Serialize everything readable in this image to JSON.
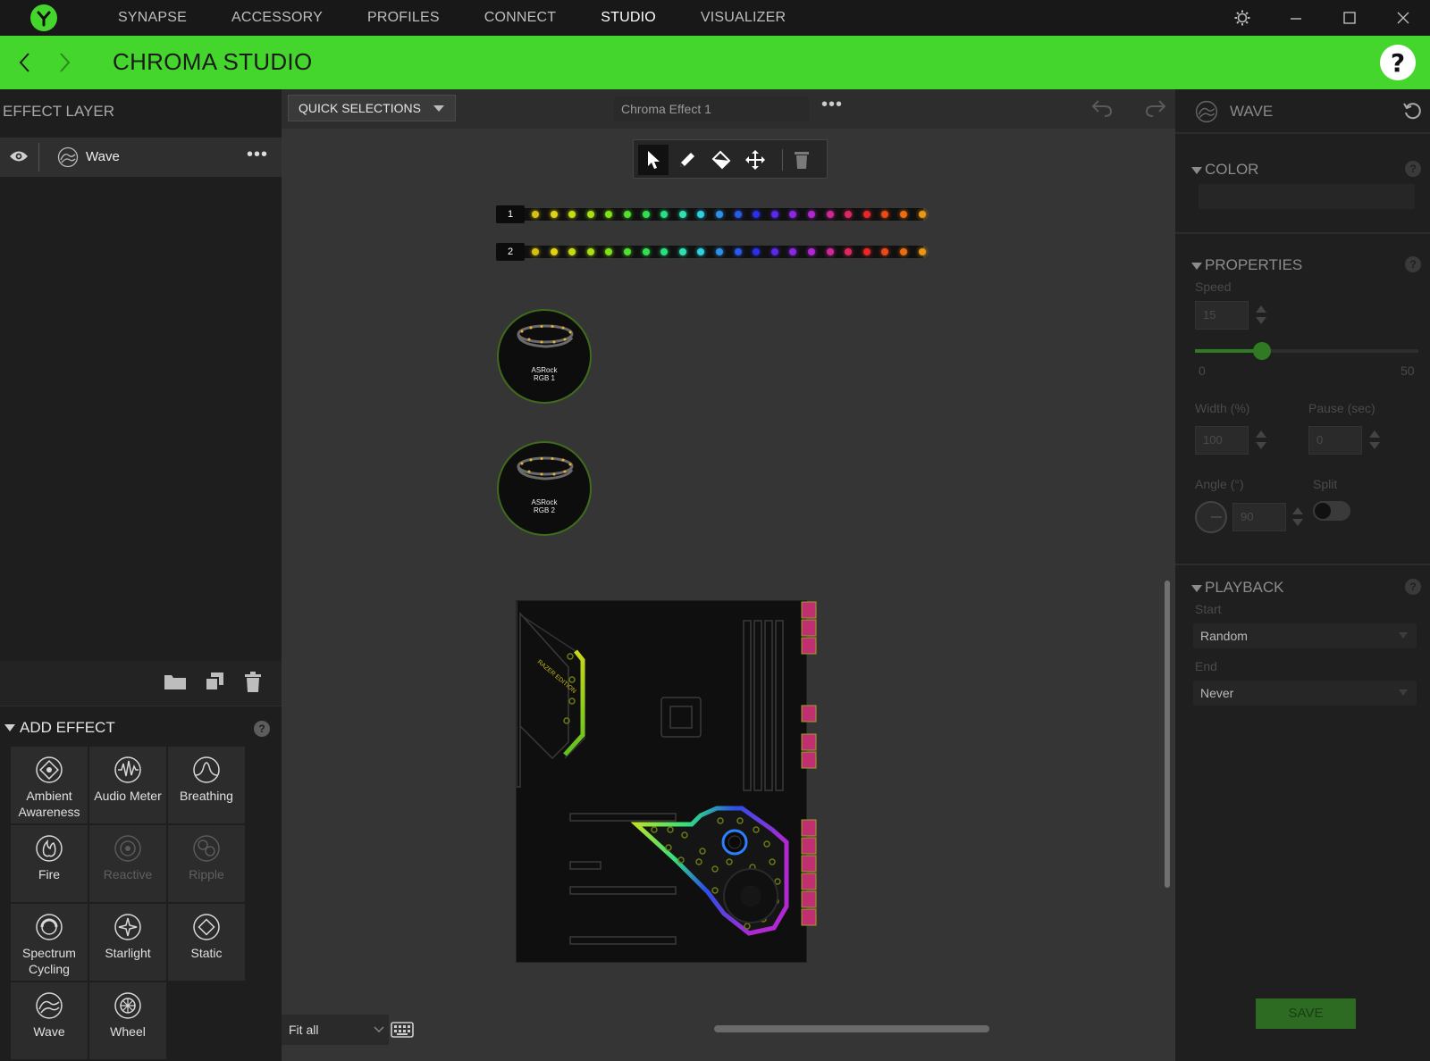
{
  "nav": {
    "items": [
      "SYNAPSE",
      "ACCESSORY",
      "PROFILES",
      "CONNECT",
      "STUDIO",
      "VISUALIZER"
    ],
    "active_index": 4
  },
  "header": {
    "title": "CHROMA STUDIO",
    "help": "?"
  },
  "left": {
    "title": "EFFECT LAYER",
    "layer": {
      "name": "Wave",
      "more": "•••"
    }
  },
  "add_effect": {
    "title": "ADD EFFECT",
    "help": "?",
    "tiles": [
      {
        "label": "Ambient Awareness",
        "icon": "ambient-awareness-icon",
        "enabled": true
      },
      {
        "label": "Audio Meter",
        "icon": "audio-meter-icon",
        "enabled": true
      },
      {
        "label": "Breathing",
        "icon": "breathing-icon",
        "enabled": true
      },
      {
        "label": "Fire",
        "icon": "fire-icon",
        "enabled": true
      },
      {
        "label": "Reactive",
        "icon": "reactive-icon",
        "enabled": false
      },
      {
        "label": "Ripple",
        "icon": "ripple-icon",
        "enabled": false
      },
      {
        "label": "Spectrum Cycling",
        "icon": "spectrum-cycling-icon",
        "enabled": true
      },
      {
        "label": "Starlight",
        "icon": "starlight-icon",
        "enabled": true
      },
      {
        "label": "Static",
        "icon": "static-icon",
        "enabled": true
      },
      {
        "label": "Wave",
        "icon": "wave-icon",
        "enabled": true
      },
      {
        "label": "Wheel",
        "icon": "wheel-icon",
        "enabled": true
      }
    ]
  },
  "center": {
    "quick_selections": "QUICK SELECTIONS",
    "effect_name": "Chroma Effect 1",
    "effect_more": "•••",
    "strip1_label": "1",
    "strip2_label": "2",
    "ring1": {
      "line1": "ASRock",
      "line2": "RGB 1"
    },
    "ring2": {
      "line1": "ASRock",
      "line2": "RGB 2"
    },
    "fit": "Fit all",
    "led_colors": [
      "#d4c012",
      "#e0d214",
      "#c8dc14",
      "#a8e014",
      "#80e01a",
      "#50e030",
      "#30e050",
      "#28e080",
      "#30e0b0",
      "#30d0e0",
      "#3090e8",
      "#2a5ae8",
      "#2a30e8",
      "#5a28e8",
      "#8a28e0",
      "#b028d0",
      "#d02898",
      "#e02860",
      "#e82828",
      "#e84a18",
      "#e86e14",
      "#e89812"
    ]
  },
  "right": {
    "title": "WAVE",
    "color_section": "COLOR",
    "properties_section": "PROPERTIES",
    "speed_label": "Speed",
    "speed_value": "15",
    "speed_min": "0",
    "speed_max": "50",
    "speed_fraction": 0.3,
    "width_label": "Width (%)",
    "width_value": "100",
    "pause_label": "Pause (sec)",
    "pause_value": "0",
    "angle_label": "Angle (°)",
    "angle_value": "90",
    "split_label": "Split",
    "playback_section": "PLAYBACK",
    "start_label": "Start",
    "start_value": "Random",
    "end_label": "End",
    "end_value": "Never",
    "save": "SAVE"
  },
  "colors": {
    "accent": "#44d62c",
    "panel": "#1e1e1e",
    "canvas": "#353535"
  }
}
